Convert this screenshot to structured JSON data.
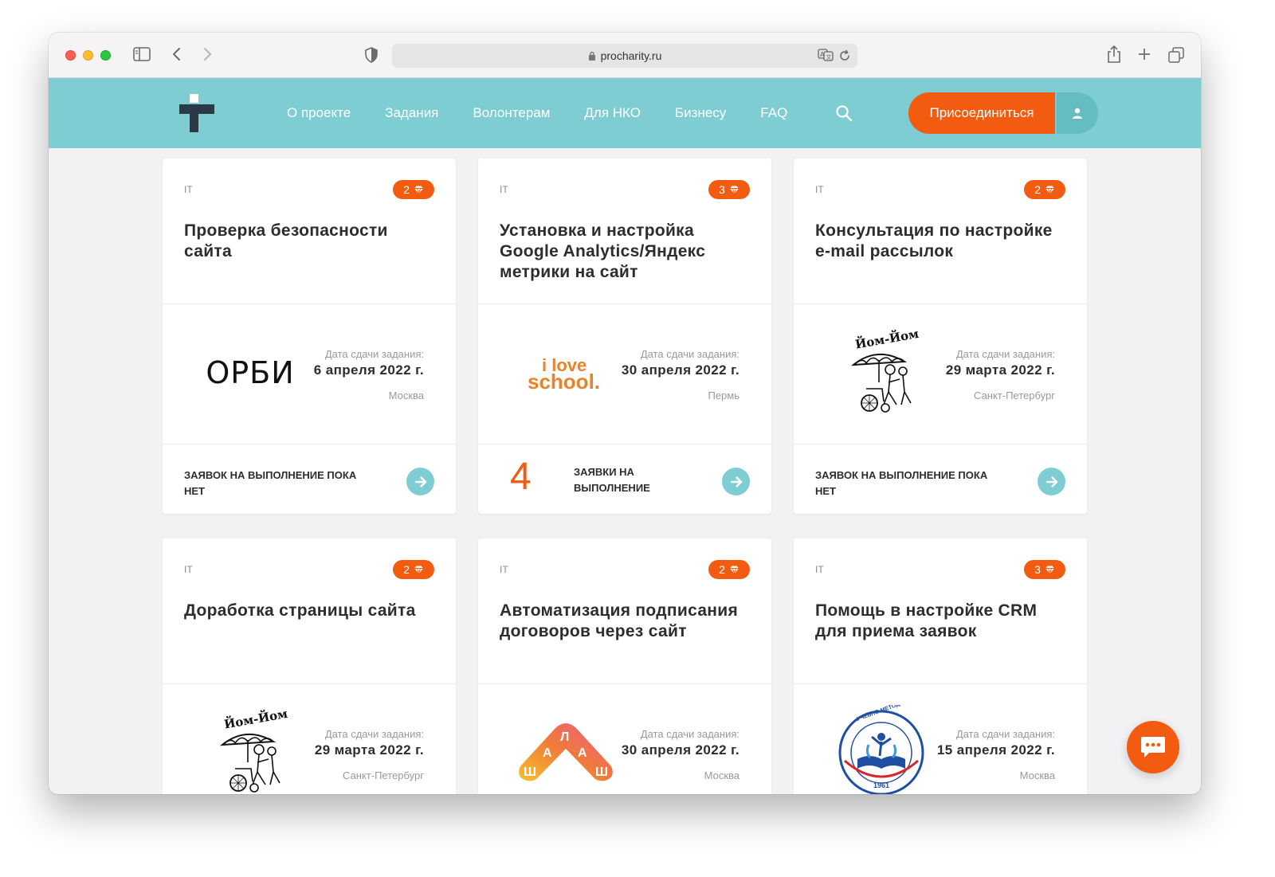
{
  "browser": {
    "url": "procharity.ru"
  },
  "nav": {
    "items": [
      "О проекте",
      "Задания",
      "Волонтерам",
      "Для НКО",
      "Бизнесу",
      "FAQ"
    ],
    "join_label": "Присоединиться"
  },
  "colors": {
    "header_bg": "#7ecdd3",
    "accent": "#f25b10",
    "user_btn": "#65bcc3"
  },
  "cards": [
    {
      "category": "IT",
      "points": "2",
      "title": "Проверка безопасности сайта",
      "logo": "ОРБИ",
      "due_label": "Дата сдачи задания:",
      "due_date": "6 апреля 2022 г.",
      "city": "Москва",
      "apps_text": "ЗАЯВОК НА ВЫПОЛНЕНИЕ ПОКА НЕТ"
    },
    {
      "category": "IT",
      "points": "3",
      "title": "Установка и настройка Google Analytics/Яндекс метрики на сайт",
      "logo": "i love school.",
      "due_label": "Дата сдачи задания:",
      "due_date": "30 апреля 2022 г.",
      "city": "Пермь",
      "apps_count": "4",
      "apps_count_text": "ЗАЯВКИ НА ВЫПОЛНЕНИЕ"
    },
    {
      "category": "IT",
      "points": "2",
      "title": "Консультация по настройке e-mail рассылок",
      "logo": "Йом-Йом",
      "due_label": "Дата сдачи задания:",
      "due_date": "29 марта 2022 г.",
      "city": "Санкт-Петербург",
      "apps_text": "ЗАЯВОК НА ВЫПОЛНЕНИЕ ПОКА НЕТ"
    },
    {
      "category": "IT",
      "points": "2",
      "title": "Доработка страницы сайта",
      "logo": "Йом-Йом",
      "due_label": "Дата сдачи задания:",
      "due_date": "29 марта 2022 г.",
      "city": "Санкт-Петербург"
    },
    {
      "category": "IT",
      "points": "2",
      "title": "Автоматизация подписания договоров через сайт",
      "logo": "ШАЛАШ",
      "due_label": "Дата сдачи задания:",
      "due_date": "30 апреля 2022 г.",
      "city": "Москва"
    },
    {
      "category": "IT",
      "points": "3",
      "title": "Помощь в настройке CRM для приема заявок",
      "logo": "УЧЕБНО-МЕТОДИЧЕСКИЙ ЦЕНТР ВОГ 1961",
      "due_label": "Дата сдачи задания:",
      "due_date": "15 апреля 2022 г.",
      "city": "Москва"
    }
  ]
}
